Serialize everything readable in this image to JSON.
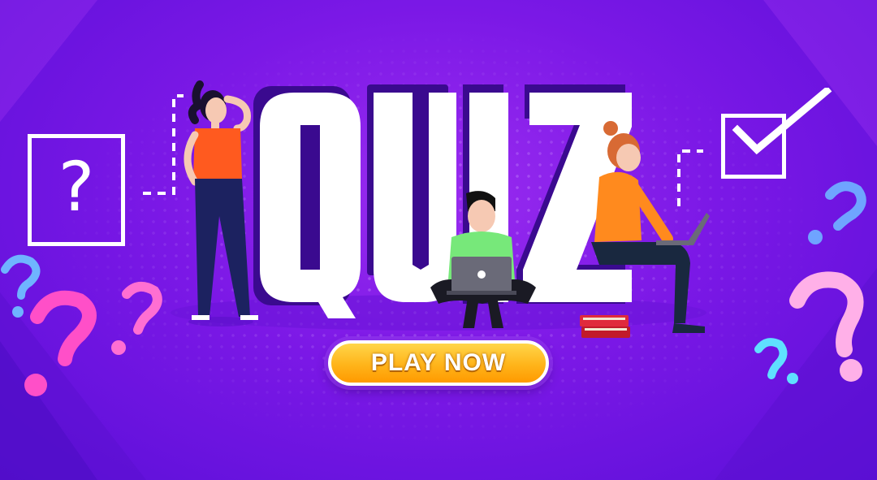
{
  "banner": {
    "title": "QUIZ",
    "question_box_glyph": "?",
    "play_button_label": "PLAY NOW"
  },
  "colors": {
    "background": "#7b18e6",
    "title_fill": "#ffffff",
    "title_shadow": "#3a0a8f",
    "button_fill": "#ffb41a",
    "question_pink": "#ff4fc8",
    "question_light_pink": "#ffb0e8",
    "question_blue": "#66a8ff",
    "question_cyan": "#5fe0ff"
  },
  "icons": [
    "question-box-icon",
    "checkbox-icon",
    "question-mark-icon",
    "laptop-icon",
    "book-icon"
  ]
}
